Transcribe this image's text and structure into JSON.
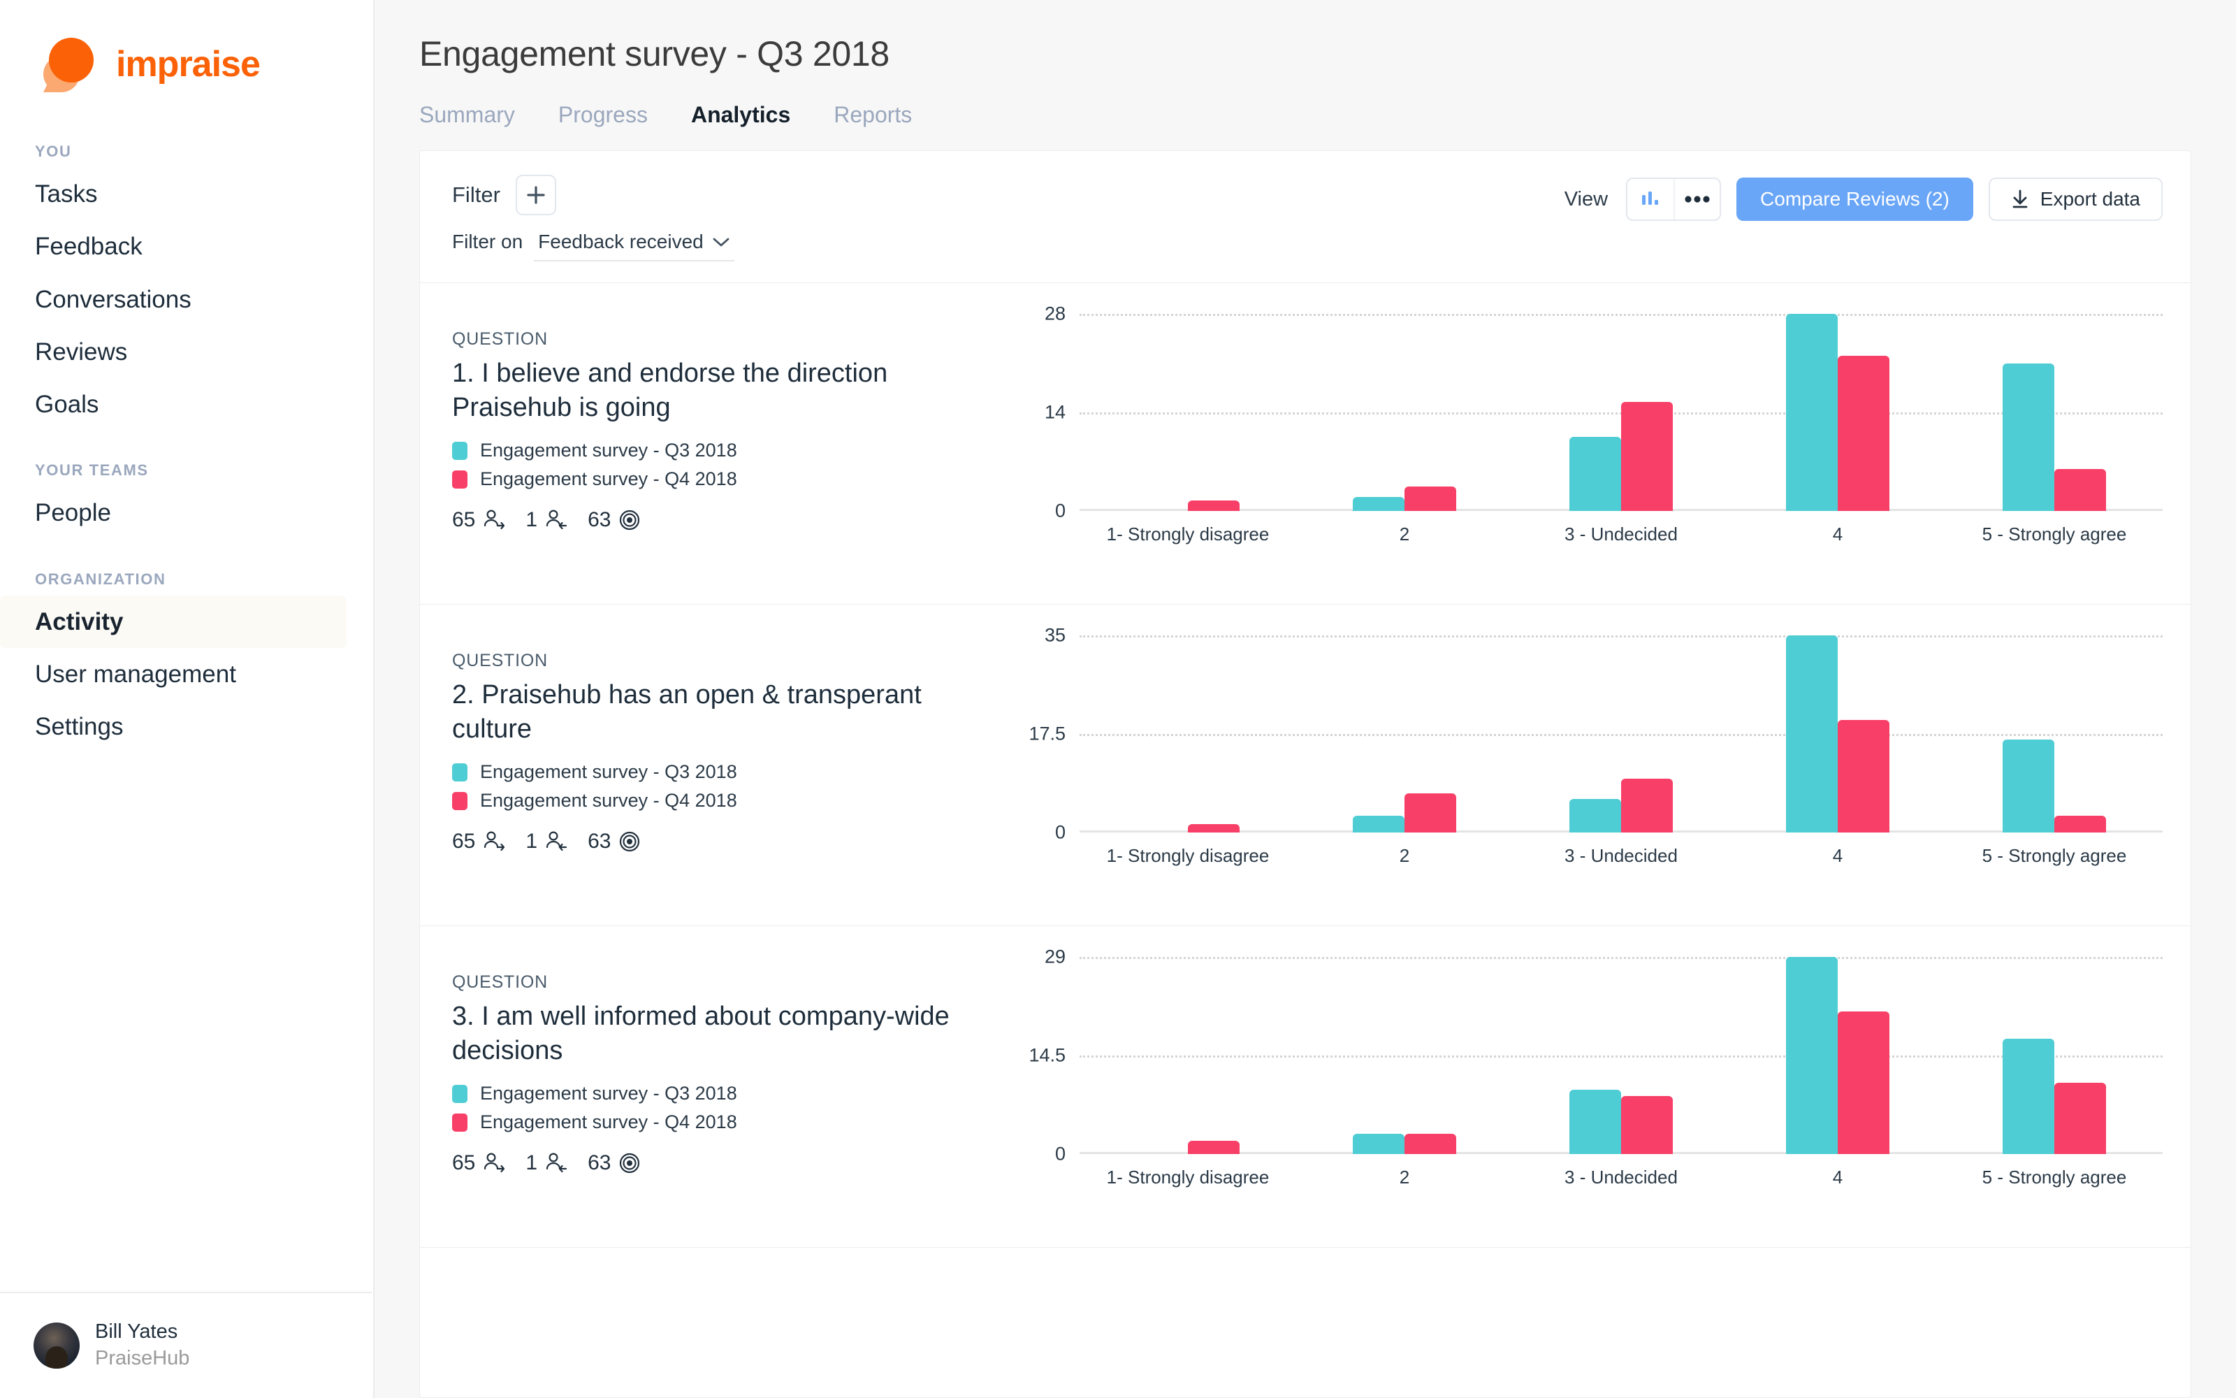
{
  "brand": {
    "name": "impraise",
    "color": "#fb6107",
    "logo_icon": "impraise-droplet-logo"
  },
  "sidebar": {
    "groups": [
      {
        "label": "YOU",
        "items": [
          {
            "label": "Tasks",
            "active": false
          },
          {
            "label": "Feedback",
            "active": false
          },
          {
            "label": "Conversations",
            "active": false
          },
          {
            "label": "Reviews",
            "active": false
          },
          {
            "label": "Goals",
            "active": false
          }
        ]
      },
      {
        "label": "YOUR TEAMS",
        "items": [
          {
            "label": "People",
            "active": false
          }
        ]
      },
      {
        "label": "ORGANIZATION",
        "items": [
          {
            "label": "Activity",
            "active": true
          },
          {
            "label": "User management",
            "active": false
          },
          {
            "label": "Settings",
            "active": false
          }
        ]
      }
    ],
    "user": {
      "name": "Bill Yates",
      "organization": "PraiseHub",
      "avatar_icon": "user-photo-avatar"
    }
  },
  "header": {
    "title": "Engagement survey - Q3 2018",
    "tabs": [
      {
        "label": "Summary",
        "active": false
      },
      {
        "label": "Progress",
        "active": false
      },
      {
        "label": "Analytics",
        "active": true
      },
      {
        "label": "Reports",
        "active": false
      }
    ]
  },
  "toolbar": {
    "filter_label": "Filter",
    "add_filter_icon": "plus-icon",
    "filter_on_label": "Filter on",
    "filter_on_value": "Feedback received",
    "filter_on_chevron_icon": "chevron-down-icon",
    "view_label": "View",
    "view_options": [
      {
        "icon": "bar-chart-icon",
        "active": true
      },
      {
        "icon": "dots-icon",
        "active": false
      }
    ],
    "compare_reviews_label": "Compare Reviews (2)",
    "compare_reviews_color": "#6aa6f7",
    "export_icon": "download-icon",
    "export_label": "Export data"
  },
  "legend_colors": {
    "q3": "#4ecdd4",
    "q4": "#f83f67"
  },
  "questions": [
    {
      "kicker": "QUESTION",
      "title": "1. I believe and endorse the direction Praisehub is going",
      "legend": [
        {
          "label": "Engagement survey - Q3 2018",
          "color": "#4ecdd4"
        },
        {
          "label": "Engagement survey - Q4 2018",
          "color": "#f83f67"
        }
      ],
      "stats": [
        {
          "value": "65",
          "icon": "person-arrow-right-icon"
        },
        {
          "value": "1",
          "icon": "person-arrow-left-icon"
        },
        {
          "value": "63",
          "icon": "target-icon"
        }
      ]
    },
    {
      "kicker": "QUESTION",
      "title": "2. Praisehub has an open & transperant culture",
      "legend": [
        {
          "label": "Engagement survey - Q3 2018",
          "color": "#4ecdd4"
        },
        {
          "label": "Engagement survey - Q4 2018",
          "color": "#f83f67"
        }
      ],
      "stats": [
        {
          "value": "65",
          "icon": "person-arrow-right-icon"
        },
        {
          "value": "1",
          "icon": "person-arrow-left-icon"
        },
        {
          "value": "63",
          "icon": "target-icon"
        }
      ]
    },
    {
      "kicker": "QUESTION",
      "title": "3. I am well informed about company-wide decisions",
      "legend": [
        {
          "label": "Engagement survey - Q3 2018",
          "color": "#4ecdd4"
        },
        {
          "label": "Engagement survey - Q4 2018",
          "color": "#f83f67"
        }
      ],
      "stats": [
        {
          "value": "65",
          "icon": "person-arrow-right-icon"
        },
        {
          "value": "1",
          "icon": "person-arrow-left-icon"
        },
        {
          "value": "63",
          "icon": "target-icon"
        }
      ]
    }
  ],
  "chart_data": [
    {
      "type": "bar",
      "title": "1. I believe and endorse the direction Praisehub is going",
      "categories": [
        "1- Strongly disagree",
        "2",
        "3 - Undecided",
        "4",
        "5 - Strongly agree"
      ],
      "series": [
        {
          "name": "Engagement survey - Q3 2018",
          "color": "#4ecdd4",
          "values": [
            0,
            2,
            10.5,
            28,
            21
          ]
        },
        {
          "name": "Engagement survey - Q4 2018",
          "color": "#f83f67",
          "values": [
            1.5,
            3.5,
            15.5,
            22,
            6
          ]
        }
      ],
      "yticks": [
        0,
        14,
        28
      ],
      "ylim": [
        0,
        28
      ],
      "xlabel": "",
      "ylabel": "",
      "grid": true,
      "legend_position": "left-panel"
    },
    {
      "type": "bar",
      "title": "2. Praisehub has an open & transperant culture",
      "categories": [
        "1- Strongly disagree",
        "2",
        "3 - Undecided",
        "4",
        "5 - Strongly agree"
      ],
      "series": [
        {
          "name": "Engagement survey - Q3 2018",
          "color": "#4ecdd4",
          "values": [
            0,
            3,
            6,
            35,
            16.5
          ]
        },
        {
          "name": "Engagement survey - Q4 2018",
          "color": "#f83f67",
          "values": [
            1.5,
            7,
            9.5,
            20,
            3
          ]
        }
      ],
      "yticks": [
        0,
        17.5,
        35
      ],
      "ylim": [
        0,
        35
      ],
      "xlabel": "",
      "ylabel": "",
      "grid": true,
      "legend_position": "left-panel"
    },
    {
      "type": "bar",
      "title": "3. I am well informed about company-wide decisions",
      "categories": [
        "1- Strongly disagree",
        "2",
        "3 - Undecided",
        "4",
        "5 - Strongly agree"
      ],
      "series": [
        {
          "name": "Engagement survey - Q3 2018",
          "color": "#4ecdd4",
          "values": [
            0,
            3,
            9.5,
            29,
            17
          ]
        },
        {
          "name": "Engagement survey - Q4 2018",
          "color": "#f83f67",
          "values": [
            2,
            3,
            8.5,
            21,
            10.5
          ]
        }
      ],
      "yticks": [
        0,
        14.5,
        29
      ],
      "ylim": [
        0,
        29
      ],
      "xlabel": "",
      "ylabel": "",
      "grid": true,
      "legend_position": "left-panel"
    }
  ]
}
